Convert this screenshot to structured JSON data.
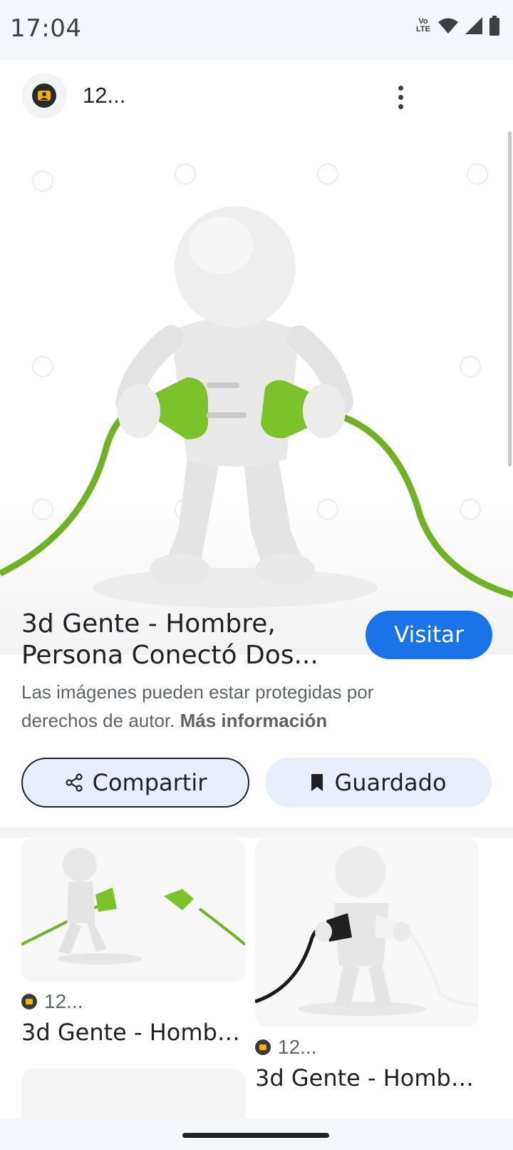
{
  "status_bar": {
    "time": "17:04",
    "icons": [
      "volte-icon",
      "wifi-icon",
      "signal-icon",
      "battery-icon"
    ],
    "volte_text": "Vo LTE"
  },
  "source": {
    "name": "12...",
    "icon": "user-badge-icon"
  },
  "hero": {
    "description_icon": "3d-man-plugs-image"
  },
  "result": {
    "title": "3d Gente - Hombre, Persona Conectó Dos...",
    "visit_label": "Visitar",
    "copyright_text": "Las imágenes pueden estar protegidas por derechos de autor.",
    "more_info_label": "Más información"
  },
  "actions": {
    "share_label": "Compartir",
    "saved_label": "Guardado"
  },
  "related": [
    {
      "source": "12...",
      "title": "3d Gente - Hombr..."
    },
    {
      "source": "12...",
      "title": "3d Gente - Hombr..."
    }
  ],
  "colors": {
    "accent": "#1a73e8",
    "chip": "#e8eefb",
    "plug_green": "#7cc22a"
  }
}
